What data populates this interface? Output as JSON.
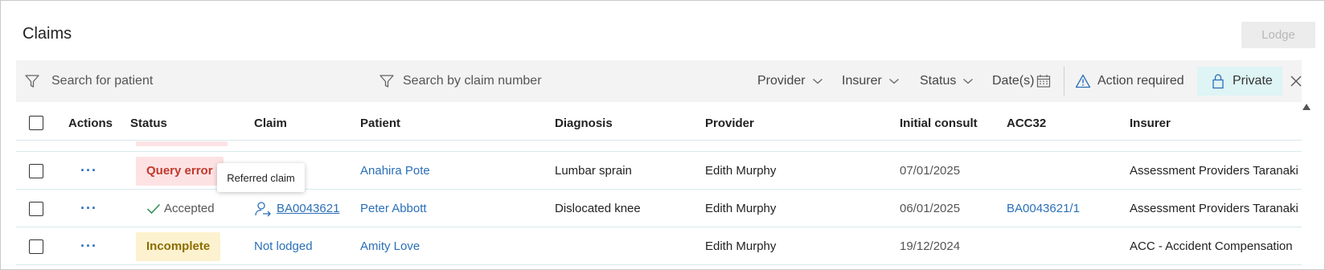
{
  "page": {
    "title": "Claims",
    "lodge_label": "Lodge"
  },
  "filters": {
    "patient_placeholder": "Search for patient",
    "claim_placeholder": "Search by claim number",
    "provider_label": "Provider",
    "insurer_label": "Insurer",
    "status_label": "Status",
    "dates_label": "Date(s)",
    "action_required_label": "Action required",
    "private_label": "Private"
  },
  "table": {
    "columns": {
      "actions": "Actions",
      "status": "Status",
      "claim": "Claim",
      "patient": "Patient",
      "diagnosis": "Diagnosis",
      "provider": "Provider",
      "initial_consult": "Initial consult",
      "acc32": "ACC32",
      "insurer": "Insurer"
    },
    "rows": [
      {
        "actions": "···",
        "status": "Query error",
        "claim": "",
        "patient": "Anahira Pote",
        "diagnosis": "Lumbar sprain",
        "provider": "Edith Murphy",
        "initial_consult": "07/01/2025",
        "acc32": "",
        "insurer": "Assessment Providers Taranaki"
      },
      {
        "actions": "···",
        "status": "Accepted",
        "claim": "BA0043621",
        "patient": "Peter Abbott",
        "diagnosis": "Dislocated knee",
        "provider": "Edith Murphy",
        "initial_consult": "06/01/2025",
        "acc32": "BA0043621/1",
        "insurer": "Assessment Providers Taranaki"
      },
      {
        "actions": "···",
        "status": "Incomplete",
        "claim": "Not lodged",
        "patient": "Amity Love",
        "diagnosis": "",
        "provider": "Edith Murphy",
        "initial_consult": "19/12/2024",
        "acc32": "",
        "insurer": "ACC - Accident Compensation"
      }
    ]
  },
  "tooltip": {
    "text": "Referred claim"
  },
  "colors": {
    "link": "#2a6fb8",
    "error_bg": "#fde2e4",
    "error_fg": "#c0392b",
    "incomplete_bg": "#fdf2cf",
    "private_bg": "#dff4f4"
  }
}
